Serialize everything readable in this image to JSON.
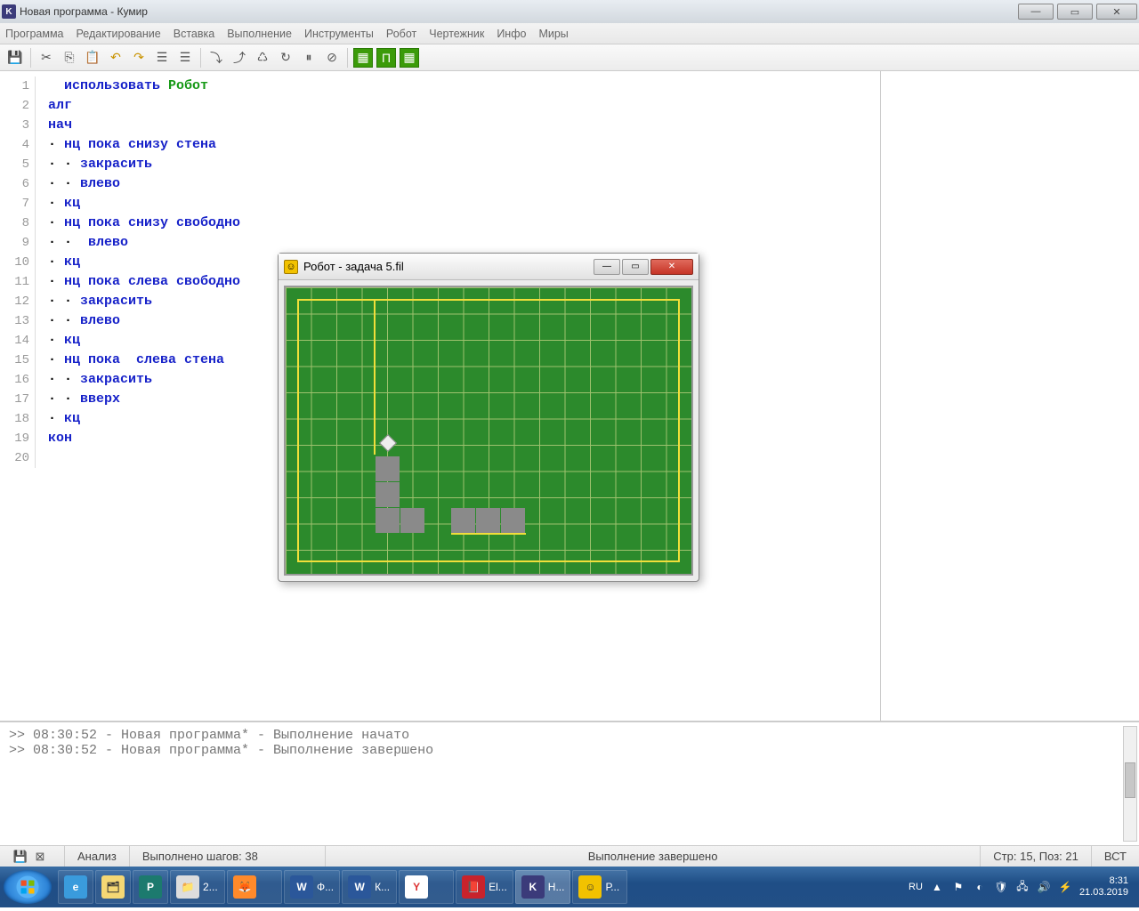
{
  "window": {
    "title": "Новая программа - Кумир",
    "icon_letter": "K"
  },
  "menu": [
    "Программа",
    "Редактирование",
    "Вставка",
    "Выполнение",
    "Инструменты",
    "Робот",
    "Чертежник",
    "Инфо",
    "Миры"
  ],
  "code_lines": [
    {
      "n": 1,
      "segs": [
        [
          "  ",
          "black"
        ],
        [
          "использовать ",
          "kw-blue"
        ],
        [
          "Робот",
          "kw-green"
        ]
      ]
    },
    {
      "n": 2,
      "segs": [
        [
          "алг",
          "kw-blue"
        ]
      ]
    },
    {
      "n": 3,
      "segs": [
        [
          "нач",
          "kw-blue"
        ]
      ]
    },
    {
      "n": 4,
      "segs": [
        [
          "· ",
          "dot"
        ],
        [
          "нц пока ",
          "kw-blue"
        ],
        [
          "снизу стена",
          "kw-blue"
        ]
      ]
    },
    {
      "n": 5,
      "segs": [
        [
          "· · ",
          "dot"
        ],
        [
          "закрасить",
          "kw-blue"
        ]
      ]
    },
    {
      "n": 6,
      "segs": [
        [
          "· · ",
          "dot"
        ],
        [
          "влево",
          "kw-blue"
        ]
      ]
    },
    {
      "n": 7,
      "segs": [
        [
          "· ",
          "dot"
        ],
        [
          "кц",
          "kw-blue"
        ]
      ]
    },
    {
      "n": 8,
      "segs": [
        [
          "· ",
          "dot"
        ],
        [
          "нц пока ",
          "kw-blue"
        ],
        [
          "снизу свободно",
          "kw-blue"
        ]
      ]
    },
    {
      "n": 9,
      "segs": [
        [
          "· ·  ",
          "dot"
        ],
        [
          "влево",
          "kw-blue"
        ]
      ]
    },
    {
      "n": 10,
      "segs": [
        [
          "· ",
          "dot"
        ],
        [
          "кц",
          "kw-blue"
        ]
      ]
    },
    {
      "n": 11,
      "segs": [
        [
          "· ",
          "dot"
        ],
        [
          "нц пока ",
          "kw-blue"
        ],
        [
          "слева свободно",
          "kw-blue"
        ]
      ]
    },
    {
      "n": 12,
      "segs": [
        [
          "· · ",
          "dot"
        ],
        [
          "закрасить",
          "kw-blue"
        ]
      ]
    },
    {
      "n": 13,
      "segs": [
        [
          "· · ",
          "dot"
        ],
        [
          "влево",
          "kw-blue"
        ]
      ]
    },
    {
      "n": 14,
      "segs": [
        [
          "· ",
          "dot"
        ],
        [
          "кц",
          "kw-blue"
        ]
      ]
    },
    {
      "n": 15,
      "segs": [
        [
          "· ",
          "dot"
        ],
        [
          "нц пока  ",
          "kw-blue"
        ],
        [
          "слева стена",
          "kw-blue"
        ]
      ]
    },
    {
      "n": 16,
      "segs": [
        [
          "· · ",
          "dot"
        ],
        [
          "закрасить",
          "kw-blue"
        ]
      ]
    },
    {
      "n": 17,
      "segs": [
        [
          "· · ",
          "dot"
        ],
        [
          "вверх",
          "kw-blue"
        ]
      ]
    },
    {
      "n": 18,
      "segs": [
        [
          "· ",
          "dot"
        ],
        [
          "кц",
          "kw-blue"
        ]
      ]
    },
    {
      "n": 19,
      "segs": [
        [
          "кон",
          "kw-blue"
        ]
      ]
    },
    {
      "n": 20,
      "segs": [
        [
          "",
          ""
        ]
      ]
    }
  ],
  "robot_window": {
    "title": "Робот - задача 5.fil"
  },
  "console": {
    "l1": ">> 08:30:52 - Новая программа* - Выполнение начато",
    "l2": ">> 08:30:52 - Новая программа* - Выполнение завершено"
  },
  "status": {
    "analysis": "Анализ",
    "steps": "Выполнено шагов: 38",
    "done": "Выполнение завершено",
    "pos": "Стр: 15, Поз: 21",
    "ins": "ВСТ"
  },
  "taskbar": {
    "tasks": [
      {
        "label": "2...",
        "icon": "📁",
        "active": false
      },
      {
        "label": "",
        "icon": "🦊",
        "active": false,
        "bg": "#ff8a2b"
      },
      {
        "label": "Ф...",
        "icon": "W",
        "active": false,
        "bg": "#2b579a",
        "fg": "#fff"
      },
      {
        "label": "К...",
        "icon": "W",
        "active": false,
        "bg": "#2b579a",
        "fg": "#fff"
      },
      {
        "label": "",
        "icon": "Y",
        "active": false,
        "bg": "#fff",
        "fg": "#d33"
      },
      {
        "label": "El...",
        "icon": "📕",
        "active": false,
        "bg": "#c8232c",
        "fg": "#fff"
      },
      {
        "label": "Н...",
        "icon": "K",
        "active": true,
        "bg": "#3b3b7a",
        "fg": "#fff"
      },
      {
        "label": "Р...",
        "icon": "☺",
        "active": false,
        "bg": "#f2c200"
      }
    ],
    "lang": "RU",
    "time": "8:31",
    "date": "21.03.2019"
  }
}
